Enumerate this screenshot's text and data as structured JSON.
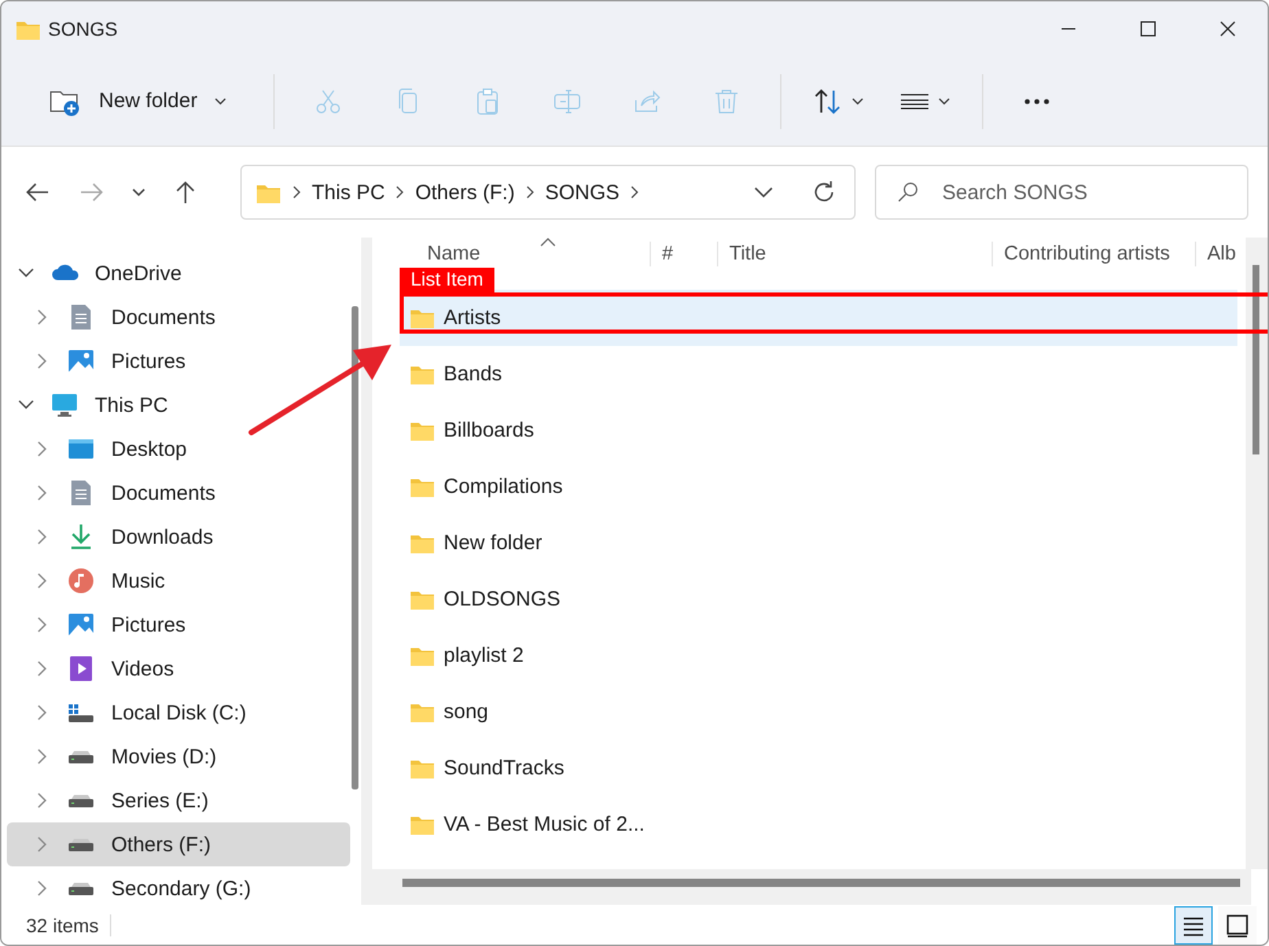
{
  "window": {
    "title": "SONGS"
  },
  "toolbar": [
    {
      "kind": "new-folder",
      "label": "New folder",
      "disabled": false
    },
    {
      "kind": "cut",
      "disabled": true
    },
    {
      "kind": "copy",
      "disabled": true
    },
    {
      "kind": "paste",
      "disabled": true
    },
    {
      "kind": "rename",
      "disabled": true
    },
    {
      "kind": "share",
      "disabled": true
    },
    {
      "kind": "delete",
      "disabled": true
    },
    {
      "kind": "sort",
      "disabled": false
    },
    {
      "kind": "view",
      "disabled": false
    },
    {
      "kind": "more",
      "disabled": false
    }
  ],
  "navigation": [
    {
      "kind": "back",
      "disabled": false
    },
    {
      "kind": "forward",
      "disabled": true
    },
    {
      "kind": "recent",
      "disabled": false
    },
    {
      "kind": "up",
      "disabled": false
    }
  ],
  "address_bar": {
    "path": [
      "This PC",
      "Others (F:)",
      "SONGS"
    ]
  },
  "search": {
    "placeholder": "Search SONGS"
  },
  "sidebar": {
    "items": [
      {
        "kind": "cloud",
        "label": "OneDrive",
        "expanded": true,
        "selected": false,
        "children": [
          {
            "kind": "documents",
            "label": "Documents",
            "expanded": false,
            "selected": false
          },
          {
            "kind": "pictures",
            "label": "Pictures",
            "expanded": false,
            "selected": false
          }
        ]
      },
      {
        "kind": "pc",
        "label": "This PC",
        "expanded": true,
        "selected": false,
        "children": [
          {
            "kind": "desktop",
            "label": "Desktop",
            "expanded": false,
            "selected": false
          },
          {
            "kind": "documents",
            "label": "Documents",
            "expanded": false,
            "selected": false
          },
          {
            "kind": "downloads",
            "label": "Downloads",
            "expanded": false,
            "selected": false
          },
          {
            "kind": "music",
            "label": "Music",
            "expanded": false,
            "selected": false
          },
          {
            "kind": "pictures",
            "label": "Pictures",
            "expanded": false,
            "selected": false
          },
          {
            "kind": "videos",
            "label": "Videos",
            "expanded": false,
            "selected": false
          },
          {
            "kind": "system-drive",
            "label": "Local Disk (C:)",
            "expanded": false,
            "selected": false
          },
          {
            "kind": "drive",
            "label": "Movies (D:)",
            "expanded": false,
            "selected": false
          },
          {
            "kind": "drive",
            "label": "Series (E:)",
            "expanded": false,
            "selected": false
          },
          {
            "kind": "drive",
            "label": "Others (F:)",
            "expanded": false,
            "selected": true
          },
          {
            "kind": "drive",
            "label": "Secondary (G:)",
            "expanded": false,
            "selected": false
          }
        ]
      }
    ]
  },
  "table": {
    "columns": [
      "Name",
      "#",
      "Title",
      "Contributing artists",
      "Alb"
    ],
    "rows": [
      {
        "name": "Artists",
        "selected": true
      },
      {
        "name": "Bands",
        "selected": false
      },
      {
        "name": "Billboards",
        "selected": false
      },
      {
        "name": "Compilations",
        "selected": false
      },
      {
        "name": "New folder",
        "selected": false
      },
      {
        "name": "OLDSONGS",
        "selected": false
      },
      {
        "name": "playlist 2",
        "selected": false
      },
      {
        "name": "song",
        "selected": false
      },
      {
        "name": "SoundTracks",
        "selected": false
      },
      {
        "name": "VA - Best Music of 2...",
        "selected": false
      }
    ]
  },
  "status_bar": {
    "count": "32 items",
    "views": [
      {
        "kind": "details",
        "selected": true
      },
      {
        "kind": "tiles",
        "selected": false
      }
    ]
  },
  "annotation": {
    "label": "List Item"
  }
}
